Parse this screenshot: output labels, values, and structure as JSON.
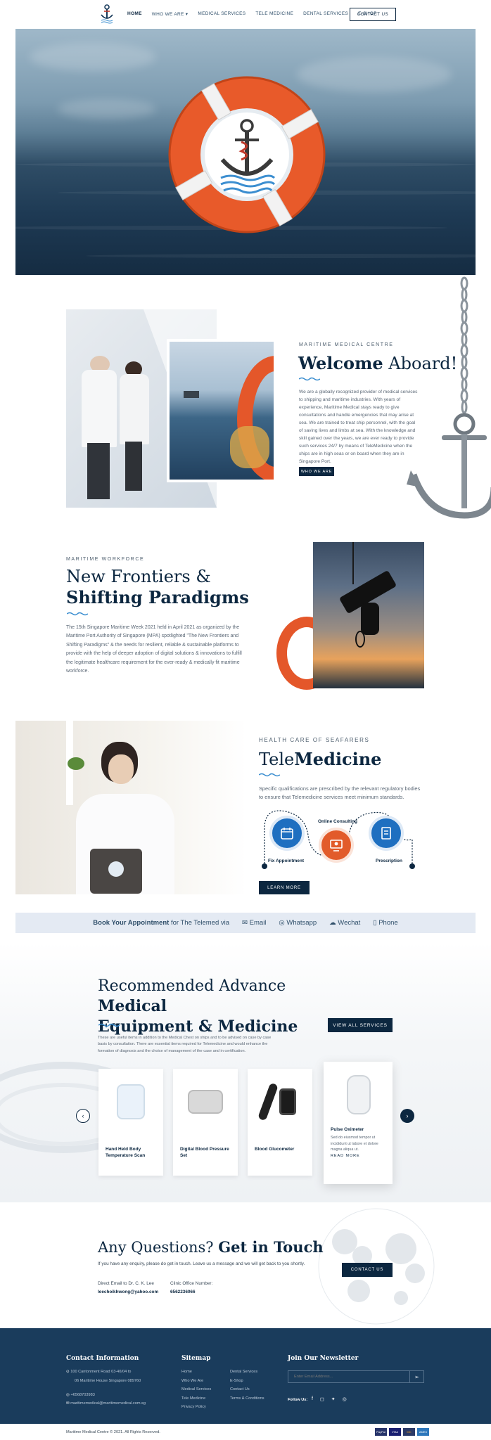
{
  "nav": {
    "items": [
      "HOME",
      "WHO WE ARE",
      "MEDICAL SERVICES",
      "TELE MEDICINE",
      "DENTAL SERVICES",
      "E-SHOP"
    ],
    "contact": "CONTACT US"
  },
  "welcome": {
    "eyebrow": "MARITIME MEDICAL CENTRE",
    "title_bold": "Welcome",
    "title_rest": " Aboard!",
    "text": "We are a globally recognized provider of medical services to shipping and maritime industries. With years of experience, Maritime Medical stays ready to give consultations and handle emergencies that may arise at sea. We are trained to treat ship personnel, with the goal of saving lives and limbs at sea. With the knowledge and skill gained over the years, we are ever ready to provide such services 24/7 by means of TeleMedicine when the ships are in high seas or on board when they are in Singapore Port.",
    "button": "WHO WE ARE"
  },
  "frontiers": {
    "eyebrow": "MARITIME WORKFORCE",
    "title_line1": "New Frontiers &",
    "title_line2": "Shifting Paradigms",
    "text": "The 15th Singapore Maritime Week 2021 held in April 2021 as organized by the Maritime Port Authority of Singapore (MPA) spotlighted \"The New Frontiers and Shifting Paradigms\" & the needs for resilient, reliable & sustainable platforms to provide with the help of deeper adoption of digital solutions & innovations to fulfill the legitimate healthcare requirement for the ever-ready & medically fit maritime workforce."
  },
  "tele": {
    "eyebrow": "HEALTH CARE OF SEAFARERS",
    "title_a": "Tele",
    "title_b": "Medicine",
    "text": "Specific qualifications are prescribed by the relevant regulatory bodies to ensure that Telemedicine services meet minimum standards.",
    "steps": [
      "Fix Appointment",
      "Online Consulting",
      "Prescription"
    ],
    "button": "LEARN MORE"
  },
  "booking": {
    "bold": "Book Your Appointment",
    "rest": " for The Telemed via",
    "channels": [
      "Email",
      "Whatsapp",
      "Wechat",
      "Phone"
    ]
  },
  "equipment": {
    "title_a": "Recommended Advance ",
    "title_b": "Medical",
    "title_c": "Equipment & Medicine",
    "text": "These are useful items in addition to the Medical Chest on ships and to be advised on case by case basis by consultation. There are essential items required for Telemedicine and would enhance the formation of diagnosis and the choice of management of the case and in certification.",
    "button": "VIEW ALL SERVICES",
    "products": [
      {
        "name": "Hand Held Body Temperature Scan"
      },
      {
        "name": "Digital Blood Pressure Set"
      },
      {
        "name": "Blood Glucometer"
      },
      {
        "name": "Pulse Oximeter",
        "desc": "Sed do eiusmod tempor ut incididunt ut labore et dolore magna aliqua ut.",
        "more": "READ MORE"
      }
    ]
  },
  "contact": {
    "title_a": "Any Questions? ",
    "title_b": "Get in Touch",
    "text": "If you have any enquiry, please do get in touch. Leave us a message and we will get back to you shortly.",
    "email_label": "Direct Email to Dr. C. K. Lee",
    "email": "leechoikhwong@yahoo.com",
    "phone_label": "Clinic Office Number:",
    "phone": "6562236066",
    "button": "CONTACT US"
  },
  "footer": {
    "contact_title": "Contact Information",
    "address1": "100 Cantonment Road 03-40/04 to",
    "address2": "06 Maritime House Singapore 089760",
    "phone": "+6568703983",
    "email": "maritimemedical@maritimemedical.com.sg",
    "sitemap_title": "Sitemap",
    "sitemap_col1": [
      "Home",
      "Who We Are",
      "Medical Services",
      "Tele Medicine",
      "Privacy Policy"
    ],
    "sitemap_col2": [
      "Dental Services",
      "E-Shop",
      "Contact Us",
      "Terms & Conditions"
    ],
    "newsletter_title": "Join Our Newsletter",
    "email_placeholder": "Enter Email Address...",
    "follow": "Follow Us:",
    "copyright": "Maritime Medical Centre © 2021. All Rights Reserved.",
    "payments": [
      "PayPal",
      "VISA",
      "MC",
      "AMEX"
    ]
  },
  "colors": {
    "navy": "#0c2740",
    "blue": "#1e6fc0",
    "orange": "#e25b2a",
    "footer": "#1a3c5c"
  }
}
